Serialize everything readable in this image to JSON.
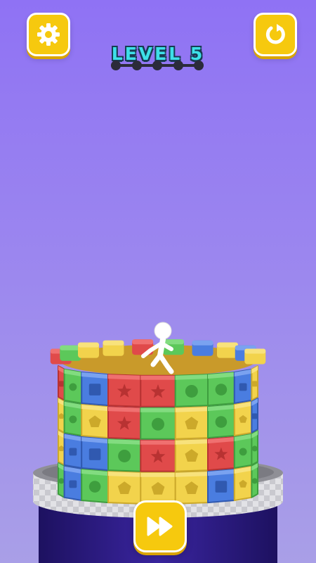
{
  "hud": {
    "level_label": "LEVEL 5",
    "level_progress": {
      "stages": 5,
      "current": 1
    }
  },
  "buttons": {
    "settings_icon": "gear-icon",
    "restart_icon": "restart-icon",
    "skip_icon": "fast-forward-icon"
  },
  "colors": {
    "background_top": "#8f72f4",
    "button_yellow": "#f6c90e",
    "level_text": "#3de0e8",
    "block_red": "#e04a4a",
    "block_green": "#5cc85a",
    "block_blue": "#4a7de0",
    "block_yellow": "#f2d34c",
    "pedestal_dark": "#2c1a7a"
  },
  "tower": {
    "rows": [
      [
        "red",
        "green",
        "blue",
        "red",
        "red",
        "green",
        "green",
        "blue",
        "yellow"
      ],
      [
        "yellow",
        "green",
        "yellow",
        "red",
        "green",
        "yellow",
        "green",
        "yellow",
        "blue"
      ],
      [
        "yellow",
        "blue",
        "blue",
        "green",
        "red",
        "yellow",
        "red",
        "green",
        "green"
      ],
      [
        "green",
        "blue",
        "green",
        "yellow",
        "yellow",
        "yellow",
        "blue",
        "yellow",
        "green"
      ]
    ],
    "symbols": [
      [
        "square",
        "circle",
        "square",
        "star",
        "star",
        "circle",
        "circle",
        "square",
        "square"
      ],
      [
        "pentagon",
        "circle",
        "pentagon",
        "star",
        "circle",
        "pentagon",
        "circle",
        "pentagon",
        "square"
      ],
      [
        "pentagon",
        "square",
        "square",
        "circle",
        "star",
        "pentagon",
        "star",
        "circle",
        "circle"
      ],
      [
        "circle",
        "square",
        "circle",
        "pentagon",
        "pentagon",
        "pentagon",
        "square",
        "pentagon",
        "circle"
      ]
    ],
    "top_rim": [
      "red",
      "green",
      "yellow",
      "yellow",
      "red",
      "green",
      "blue",
      "yellow",
      "blue",
      "yellow"
    ]
  }
}
